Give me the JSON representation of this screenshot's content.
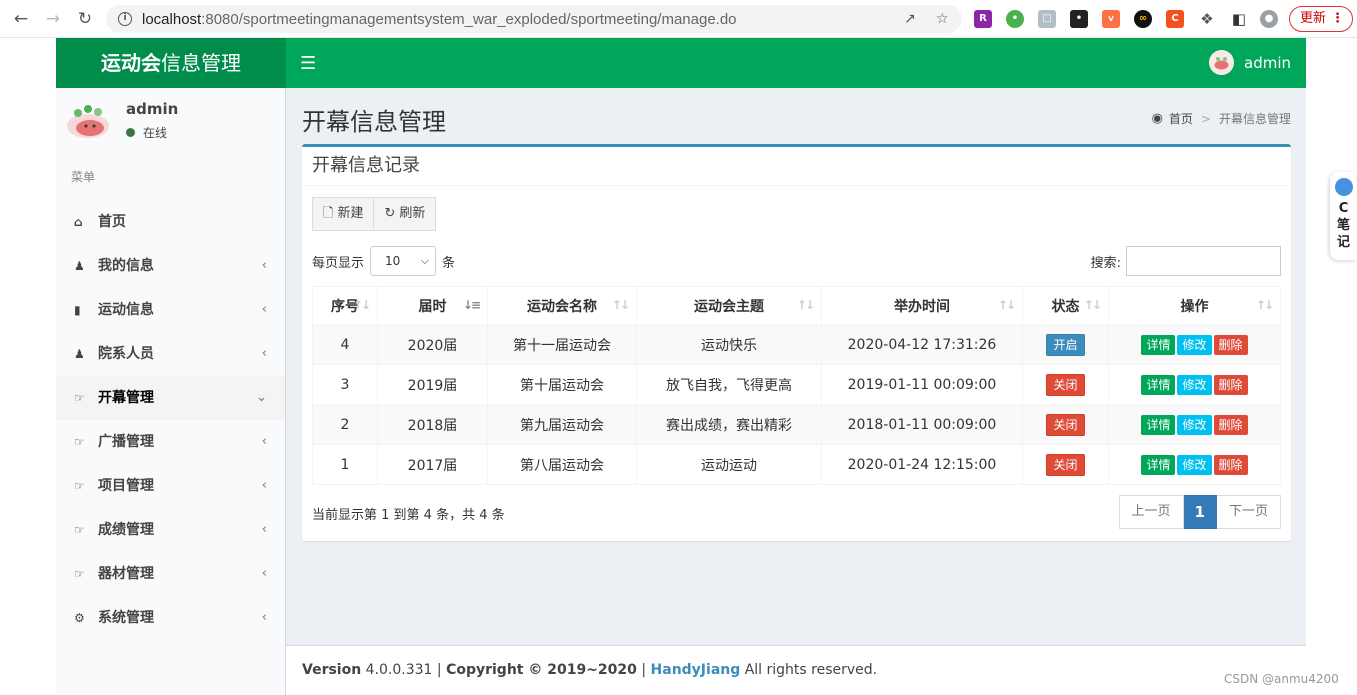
{
  "browser": {
    "url_host": "localhost",
    "url_rest": ":8080/sportmeetingmanagementsystem_war_exploded/sportmeeting/manage.do",
    "update_label": "更新"
  },
  "app": {
    "logo_bold": "运动会",
    "logo_rest": "信息管理",
    "top_user": "admin"
  },
  "sidebar": {
    "user_name": "admin",
    "user_status": "在线",
    "menu_header": "菜单",
    "items": [
      {
        "label": "首页",
        "icon": "home-icon"
      },
      {
        "label": "我的信息",
        "icon": "user-icon"
      },
      {
        "label": "运动信息",
        "icon": "bar-chart-icon"
      },
      {
        "label": "院系人员",
        "icon": "users-icon"
      },
      {
        "label": "开幕管理",
        "icon": "hand-point-icon"
      },
      {
        "label": "广播管理",
        "icon": "hand-point-icon"
      },
      {
        "label": "项目管理",
        "icon": "hand-point-icon"
      },
      {
        "label": "成绩管理",
        "icon": "hand-point-icon"
      },
      {
        "label": "器材管理",
        "icon": "hand-point-icon"
      },
      {
        "label": "系统管理",
        "icon": "gear-icon"
      }
    ]
  },
  "page": {
    "title": "开幕信息管理",
    "breadcrumb_home": "首页",
    "breadcrumb_sep": ">",
    "breadcrumb_current": "开幕信息管理"
  },
  "box": {
    "title": "开幕信息记录",
    "new_label": "新建",
    "refresh_label": "刷新",
    "length_prefix": "每页显示",
    "length_value": "10",
    "length_suffix": "条",
    "search_label": "搜索:"
  },
  "table": {
    "headers": [
      "序号",
      "届时",
      "运动会名称",
      "运动会主题",
      "举办时间",
      "状态",
      "操作"
    ],
    "rows": [
      {
        "no": "4",
        "session": "2020届",
        "name": "第十一届运动会",
        "theme": "运动快乐",
        "time": "2020-04-12 17:31:26",
        "status": "开启",
        "status_color": "#3c8dbc"
      },
      {
        "no": "3",
        "session": "2019届",
        "name": "第十届运动会",
        "theme": "放飞自我，飞得更高",
        "time": "2019-01-11 00:09:00",
        "status": "关闭",
        "status_color": "#dd4b39"
      },
      {
        "no": "2",
        "session": "2018届",
        "name": "第九届运动会",
        "theme": "赛出成绩，赛出精彩",
        "time": "2018-01-11 00:09:00",
        "status": "关闭",
        "status_color": "#dd4b39"
      },
      {
        "no": "1",
        "session": "2017届",
        "name": "第八届运动会",
        "theme": "运动运动",
        "time": "2020-01-24 12:15:00",
        "status": "关闭",
        "status_color": "#dd4b39"
      }
    ],
    "action_detail": "详情",
    "action_edit": "修改",
    "action_delete": "删除"
  },
  "pagination": {
    "info": "当前显示第 1 到第 4 条，共 4 条",
    "prev": "上一页",
    "current": "1",
    "next": "下一页"
  },
  "footer": {
    "version_label": "Version",
    "version": "4.0.0.331",
    "copyright": "Copyright © 2019~2020",
    "author": "HandyJiang",
    "rights": "All rights reserved."
  },
  "side_note": {
    "line1": "C",
    "line2": "笔",
    "line3": "记"
  },
  "watermark": "CSDN @anmu4200",
  "colors": {
    "topbar": "#00a65a",
    "logo_bg": "#008d4c",
    "primary": "#3c8dbc",
    "danger": "#dd4b39",
    "success": "#00a65a",
    "info": "#00c0ef"
  }
}
